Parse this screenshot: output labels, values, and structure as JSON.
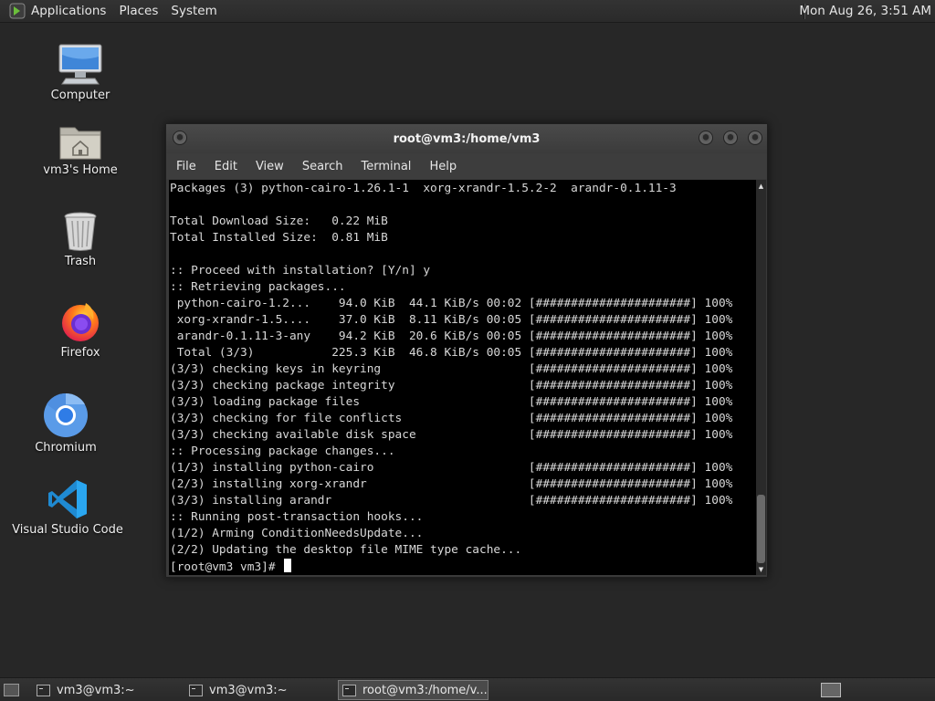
{
  "top_panel": {
    "menus": [
      "Applications",
      "Places",
      "System"
    ],
    "clock": "Mon Aug 26,  3:51 AM"
  },
  "desktop_icons": [
    {
      "label": "Computer",
      "icon": "computer-icon"
    },
    {
      "label": "vm3's Home",
      "icon": "home-folder-icon"
    },
    {
      "label": "Trash",
      "icon": "trash-icon"
    },
    {
      "label": "Firefox",
      "icon": "firefox-icon"
    },
    {
      "label": "Chromium",
      "icon": "chromium-icon"
    },
    {
      "label": "Visual Studio Code",
      "icon": "vscode-icon"
    }
  ],
  "terminal": {
    "title": "root@vm3:/home/vm3",
    "menus": [
      "File",
      "Edit",
      "View",
      "Search",
      "Terminal",
      "Help"
    ],
    "lines": [
      "Packages (3) python-cairo-1.26.1-1  xorg-xrandr-1.5.2-2  arandr-0.1.11-3",
      "",
      "Total Download Size:   0.22 MiB",
      "Total Installed Size:  0.81 MiB",
      "",
      ":: Proceed with installation? [Y/n] y",
      ":: Retrieving packages...",
      " python-cairo-1.2...    94.0 KiB  44.1 KiB/s 00:02 [######################] 100%",
      " xorg-xrandr-1.5....    37.0 KiB  8.11 KiB/s 00:05 [######################] 100%",
      " arandr-0.1.11-3-any    94.2 KiB  20.6 KiB/s 00:05 [######################] 100%",
      " Total (3/3)           225.3 KiB  46.8 KiB/s 00:05 [######################] 100%",
      "(3/3) checking keys in keyring                     [######################] 100%",
      "(3/3) checking package integrity                   [######################] 100%",
      "(3/3) loading package files                        [######################] 100%",
      "(3/3) checking for file conflicts                  [######################] 100%",
      "(3/3) checking available disk space                [######################] 100%",
      ":: Processing package changes...",
      "(1/3) installing python-cairo                      [######################] 100%",
      "(2/3) installing xorg-xrandr                       [######################] 100%",
      "(3/3) installing arandr                            [######################] 100%",
      ":: Running post-transaction hooks...",
      "(1/2) Arming ConditionNeedsUpdate...",
      "(2/2) Updating the desktop file MIME type cache..."
    ],
    "prompt": "[root@vm3 vm3]# "
  },
  "taskbar": {
    "tasks": [
      {
        "label": "vm3@vm3:~",
        "active": false
      },
      {
        "label": "vm3@vm3:~",
        "active": false
      },
      {
        "label": "root@vm3:/home/v...",
        "active": true
      }
    ]
  },
  "colors": {
    "desktop_bg": "#272727",
    "terminal_bg": "#000000",
    "terminal_fg": "#d8d8d8"
  }
}
